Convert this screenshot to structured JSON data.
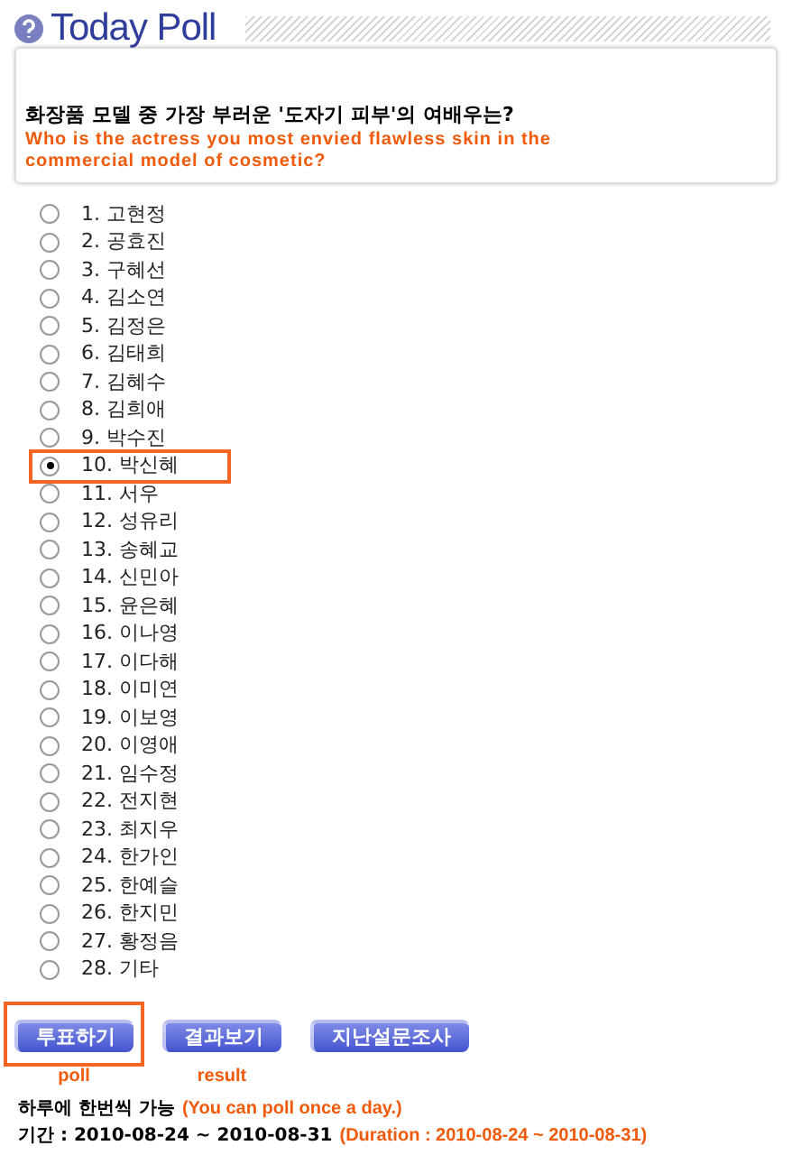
{
  "header": {
    "title": "Today Poll"
  },
  "question": {
    "korean": "화장품 모델 중 가장 부러운 '도자기 피부'의 여배우는?",
    "english": "Who is the actress you most envied flawless skin in the commercial model of cosmetic?"
  },
  "options": [
    {
      "label": "1. 고현정",
      "selected": false
    },
    {
      "label": "2. 공효진",
      "selected": false
    },
    {
      "label": "3. 구혜선",
      "selected": false
    },
    {
      "label": "4. 김소연",
      "selected": false
    },
    {
      "label": "5. 김정은",
      "selected": false
    },
    {
      "label": "6. 김태희",
      "selected": false
    },
    {
      "label": "7. 김혜수",
      "selected": false
    },
    {
      "label": "8. 김희애",
      "selected": false
    },
    {
      "label": "9. 박수진",
      "selected": false
    },
    {
      "label": "10. 박신혜",
      "selected": true
    },
    {
      "label": "11. 서우",
      "selected": false
    },
    {
      "label": "12. 성유리",
      "selected": false
    },
    {
      "label": "13. 송혜교",
      "selected": false
    },
    {
      "label": "14. 신민아",
      "selected": false
    },
    {
      "label": "15. 윤은혜",
      "selected": false
    },
    {
      "label": "16. 이나영",
      "selected": false
    },
    {
      "label": "17. 이다해",
      "selected": false
    },
    {
      "label": "18. 이미연",
      "selected": false
    },
    {
      "label": "19. 이보영",
      "selected": false
    },
    {
      "label": "20. 이영애",
      "selected": false
    },
    {
      "label": "21. 임수정",
      "selected": false
    },
    {
      "label": "22. 전지현",
      "selected": false
    },
    {
      "label": "23. 최지우",
      "selected": false
    },
    {
      "label": "24. 한가인",
      "selected": false
    },
    {
      "label": "25. 한예슬",
      "selected": false
    },
    {
      "label": "26. 한지민",
      "selected": false
    },
    {
      "label": "27. 황정음",
      "selected": false
    },
    {
      "label": "28. 기타",
      "selected": false
    }
  ],
  "buttons": [
    {
      "label": "투표하기",
      "highlighted": true,
      "annotation": "poll"
    },
    {
      "label": "결과보기",
      "highlighted": false,
      "annotation": "result"
    },
    {
      "label": "지난설문조사",
      "highlighted": false
    }
  ],
  "notes": [
    {
      "korean": "하루에 한번씩 가능",
      "english": "(You can poll once a day.)"
    },
    {
      "korean": "기간 : 2010-08-24 ~ 2010-08-31",
      "english": "(Duration : 2010-08-24 ~ 2010-08-31)"
    }
  ]
}
